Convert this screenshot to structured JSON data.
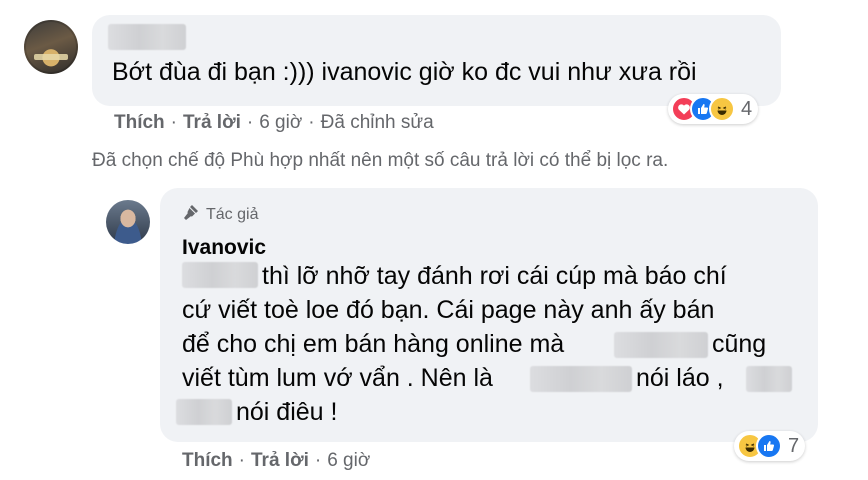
{
  "comment1": {
    "text": "Bớt đùa đi bạn :))) ivanovic giờ ko đc vui như xưa rồi",
    "actions": {
      "like": "Thích",
      "reply": "Trả lời",
      "time": "6 giờ",
      "edited": "Đã chỉnh sửa"
    },
    "reaction_count": "4",
    "reactions": [
      "love-icon",
      "like-icon",
      "haha-icon"
    ]
  },
  "filter_notice": "Đã chọn chế độ Phù hợp nhất nên một số câu trả lời có thể bị lọc ra.",
  "reply": {
    "badge": "Tác giả",
    "author": "Ivanovic",
    "lines": {
      "l1": "thì lỡ nhỡ tay đánh rơi cái cúp mà báo chí",
      "l2": "cứ viết toè loe đó bạn. Cái page này anh ấy bán",
      "l3a": "để cho chị em bán hàng online mà",
      "l3b": "cũng",
      "l4a": "viết tùm lum vớ vẩn . Nên là",
      "l4b": "nói láo ,",
      "l5": "nói điêu !"
    },
    "actions": {
      "like": "Thích",
      "reply": "Trả lời",
      "time": "6 giờ"
    },
    "reaction_count": "7",
    "reactions": [
      "haha-icon",
      "like-icon"
    ]
  },
  "colors": {
    "bubble": "#f0f2f5",
    "secondary_text": "#65676b",
    "like_blue": "#1877f2",
    "love_red": "#f33e58",
    "haha_yellow": "#f7c642"
  }
}
